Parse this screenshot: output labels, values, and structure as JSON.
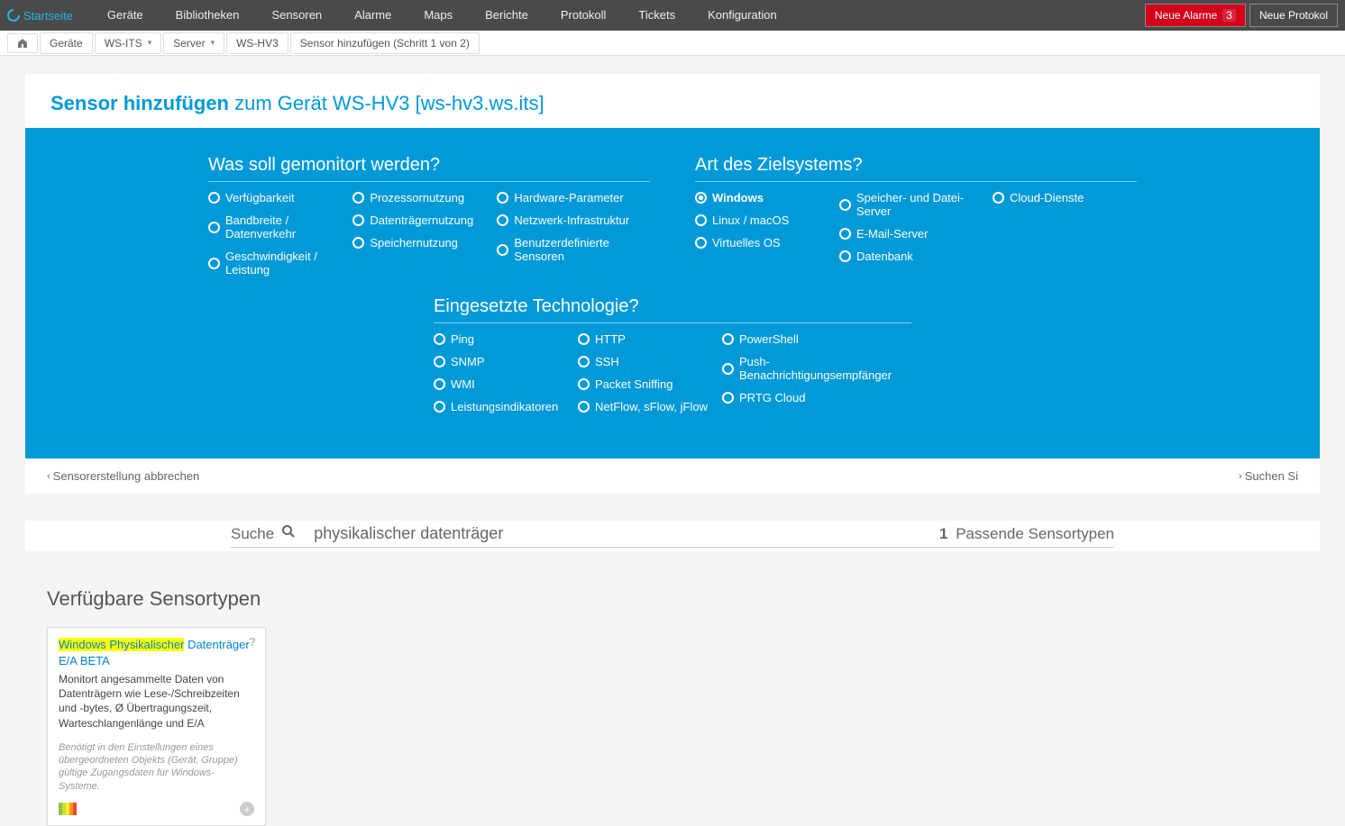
{
  "topnav": {
    "home": "Startseite",
    "items": [
      "Geräte",
      "Bibliotheken",
      "Sensoren",
      "Alarme",
      "Maps",
      "Berichte",
      "Protokoll",
      "Tickets",
      "Konfiguration"
    ],
    "alarm_label": "Neue Alarme",
    "alarm_count": "3",
    "protokoll_label": "Neue Protokol"
  },
  "breadcrumb": {
    "items": [
      "Geräte",
      "WS-ITS",
      "Server",
      "WS-HV3",
      "Sensor hinzufügen (Schritt 1 von 2)"
    ]
  },
  "page_title": {
    "strong": "Sensor hinzufügen",
    "rest": "zum Gerät WS-HV3 [ws-hv3.ws.its]"
  },
  "filters": {
    "monitor": {
      "title": "Was soll gemonitort werden?",
      "col1": [
        "Verfügbarkeit",
        "Bandbreite / Datenverkehr",
        "Geschwindigkeit / Leistung"
      ],
      "col2": [
        "Prozessornutzung",
        "Datenträgernutzung",
        "Speichernutzung"
      ],
      "col3": [
        "Hardware-Parameter",
        "Netzwerk-Infrastruktur",
        "Benutzerdefinierte Sensoren"
      ]
    },
    "target": {
      "title": "Art des Zielsystems?",
      "col1": [
        "Windows",
        "Linux / macOS",
        "Virtuelles OS"
      ],
      "col2": [
        "Speicher- und Datei-Server",
        "E-Mail-Server",
        "Datenbank"
      ],
      "col3": [
        "Cloud-Dienste"
      ],
      "selected": "Windows"
    },
    "tech": {
      "title": "Eingesetzte Technologie?",
      "col1": [
        "Ping",
        "SNMP",
        "WMI",
        "Leistungsindikatoren"
      ],
      "col2": [
        "HTTP",
        "SSH",
        "Packet Sniffing",
        "NetFlow, sFlow, jFlow"
      ],
      "col3": [
        "PowerShell",
        "Push-Benachrichtigungsempfänger",
        "PRTG Cloud"
      ]
    }
  },
  "actions": {
    "cancel": "Sensorerstellung abbrechen",
    "search_direct": "Suchen Si"
  },
  "search": {
    "label": "Suche",
    "value": "physikalischer datenträger",
    "result_count": "1",
    "result_label": "Passende Sensortypen"
  },
  "sensor_types_title": "Verfügbare Sensortypen",
  "sensor_card": {
    "title_hl": "Windows Physikalischer",
    "title_rest": "Datenträger E/A BETA",
    "desc": "Monitort angesammelte Daten von Datenträgern wie Lese-/Schreibzeiten und -bytes, Ø Übertragungszeit, Warteschlangenlänge und E/A",
    "req": "Benötigt in den Einstellungen eines übergeordneten Objekts (Gerät, Gruppe) gültige Zugangsdaten für Windows-Systeme.",
    "colors": [
      "#8bc34a",
      "#cddc39",
      "#ffeb3b",
      "#ff9800",
      "#f44336"
    ]
  }
}
